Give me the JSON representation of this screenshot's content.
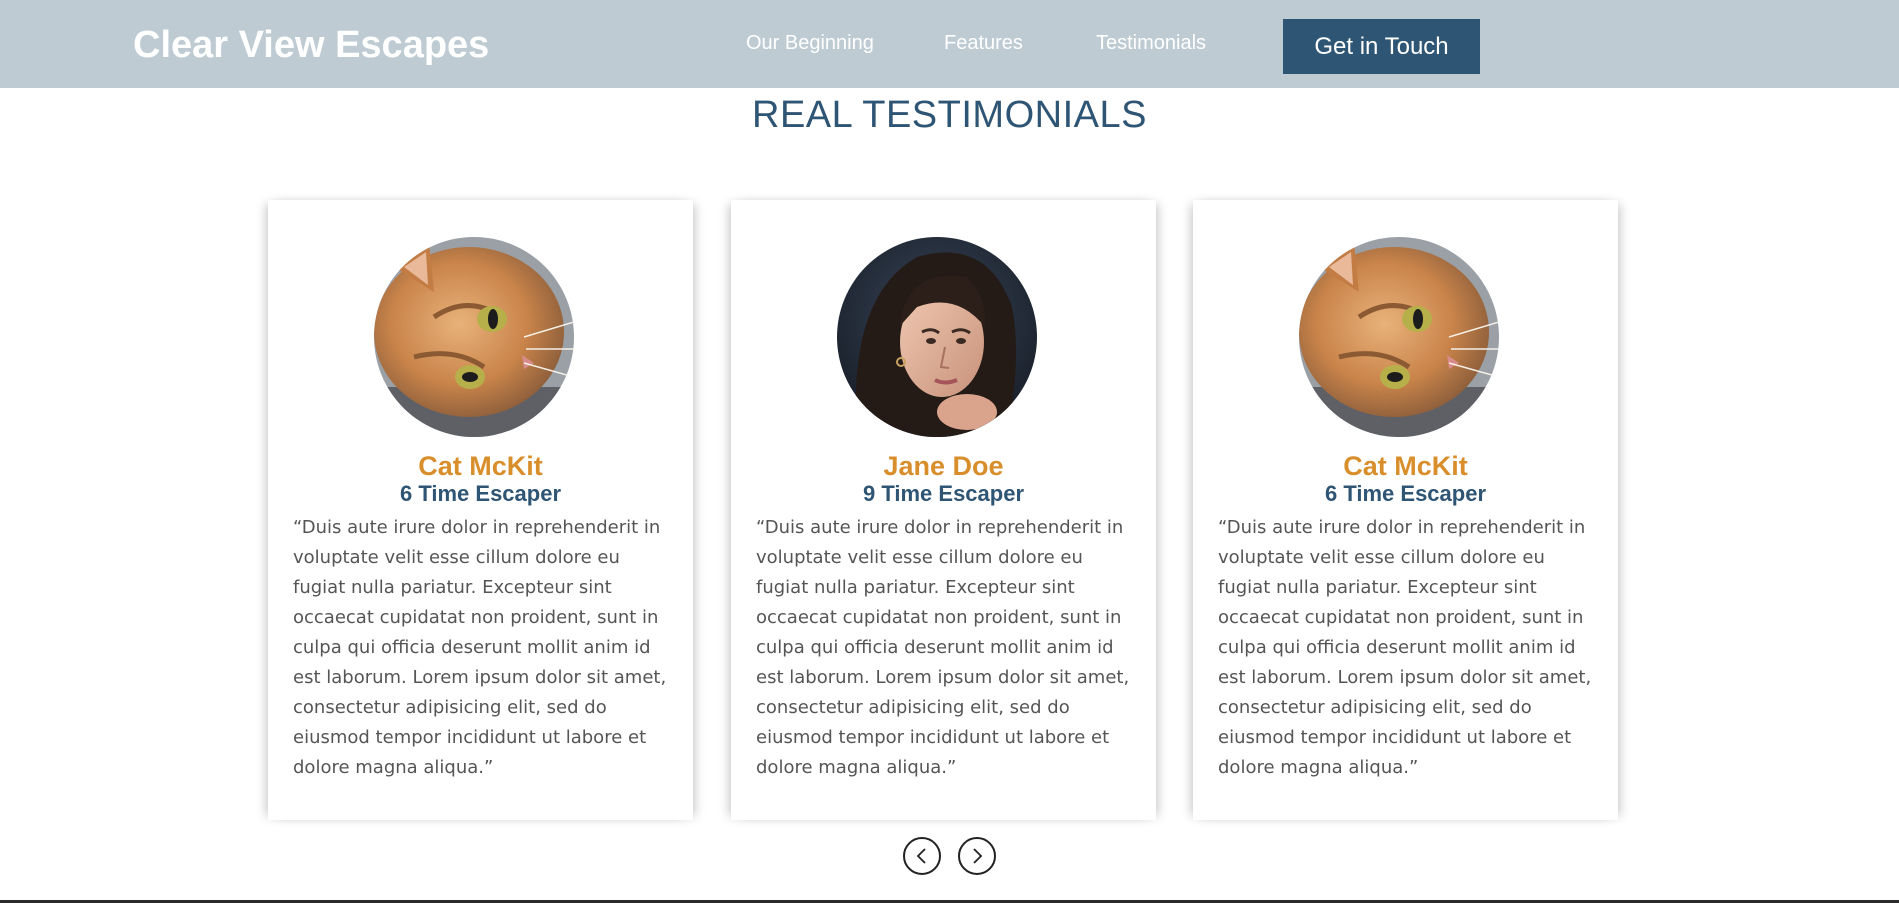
{
  "navbar": {
    "brand": "Clear View Escapes",
    "links": [
      "Our Beginning",
      "Features",
      "Testimonials"
    ],
    "cta_label": "Get in Touch"
  },
  "section": {
    "title": "REAL TESTIMONIALS"
  },
  "testimonials": [
    {
      "name": "Cat McKit",
      "role": "6 Time Escaper",
      "avatar": "cat-photo",
      "quote": "“Duis aute irure dolor in reprehenderit in voluptate velit esse cillum dolore eu fugiat nulla pariatur. Excepteur sint occaecat cupidatat non proident, sunt in culpa qui officia deserunt mollit anim id est laborum. Lorem ipsum dolor sit amet, consectetur adipisicing elit, sed do eiusmod tempor incididunt ut labore et dolore magna aliqua.”"
    },
    {
      "name": "Jane Doe",
      "role": "9 Time Escaper",
      "avatar": "woman-photo",
      "quote": "“Duis aute irure dolor in reprehenderit in voluptate velit esse cillum dolore eu fugiat nulla pariatur. Excepteur sint occaecat cupidatat non proident, sunt in culpa qui officia deserunt mollit anim id est laborum. Lorem ipsum dolor sit amet, consectetur adipisicing elit, sed do eiusmod tempor incididunt ut labore et dolore magna aliqua.”"
    },
    {
      "name": "Cat McKit",
      "role": "6 Time Escaper",
      "avatar": "cat-photo",
      "quote": "“Duis aute irure dolor in reprehenderit in voluptate velit esse cillum dolore eu fugiat nulla pariatur. Excepteur sint occaecat cupidatat non proident, sunt in culpa qui officia deserunt mollit anim id est laborum. Lorem ipsum dolor sit amet, consectetur adipisicing elit, sed do eiusmod tempor incididunt ut labore et dolore magna aliqua.”"
    }
  ],
  "carousel": {
    "prev_icon": "chevron-left-icon",
    "next_icon": "chevron-right-icon"
  },
  "colors": {
    "navbar_bg": "#becbd3",
    "accent_navy": "#2f5574",
    "name_orange": "#d98e2c"
  }
}
